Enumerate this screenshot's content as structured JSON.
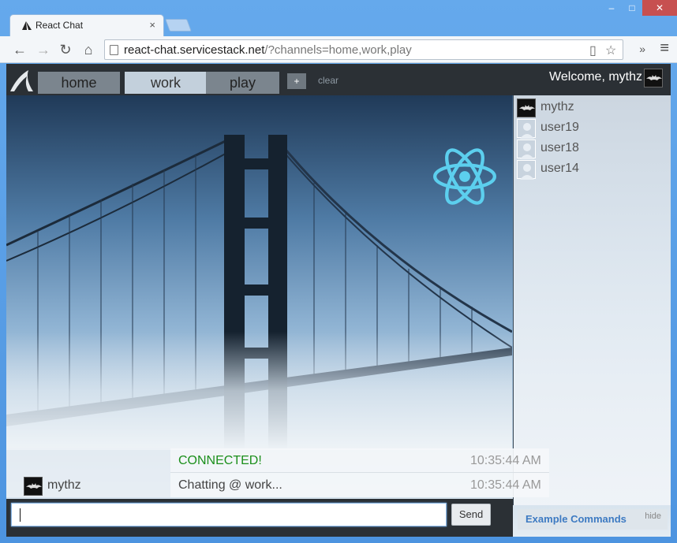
{
  "browser": {
    "tab_title": "React Chat",
    "tab_close": "×",
    "url_host": "react-chat.servicestack.net",
    "url_rest": "/?channels=home,work,play",
    "win_minimize": "–",
    "win_maximize": "□",
    "win_close": "✕",
    "back": "←",
    "forward": "→",
    "reload": "↻",
    "home": "⌂",
    "star": "☆",
    "reader": "▯",
    "more": "»",
    "menu": "≡"
  },
  "app": {
    "channels": [
      {
        "label": "home",
        "active": false
      },
      {
        "label": "work",
        "active": true
      },
      {
        "label": "play",
        "active": false
      }
    ],
    "add_label": "+",
    "clear_label": "clear",
    "welcome": "Welcome, mythz"
  },
  "users": [
    {
      "name": "mythz",
      "me": true
    },
    {
      "name": "user19",
      "me": false
    },
    {
      "name": "user18",
      "me": false
    },
    {
      "name": "user14",
      "me": false
    }
  ],
  "messages": [
    {
      "user": "",
      "text": "CONNECTED!",
      "time": "10:35:44 AM",
      "system": true
    },
    {
      "user": "mythz",
      "text": "Chatting @ work...",
      "time": "10:35:44 AM",
      "system": false
    }
  ],
  "composer": {
    "value": "",
    "send_label": "Send"
  },
  "commands": {
    "label": "Example Commands",
    "hide": "hide"
  },
  "colors": {
    "connected": "#1b8f1b",
    "react_blue": "#5ccfee",
    "toolbar_dark": "#2b3035"
  }
}
